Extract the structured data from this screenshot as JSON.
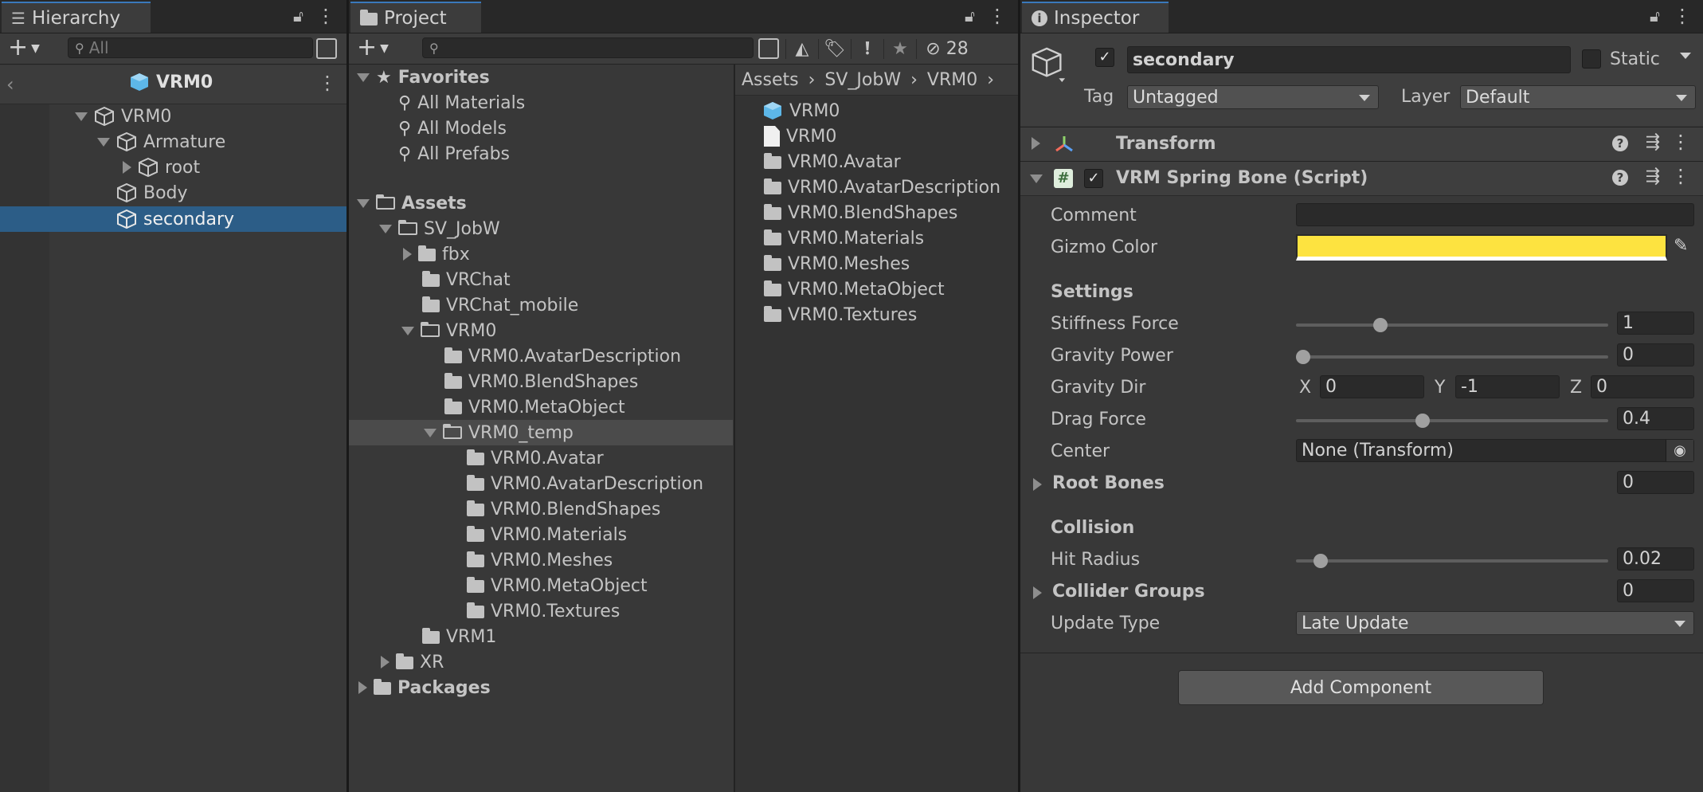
{
  "hierarchy": {
    "tab_label": "Hierarchy",
    "search_placeholder": "All",
    "scene_name": "VRM0",
    "items": [
      {
        "label": "VRM0"
      },
      {
        "label": "Armature"
      },
      {
        "label": "root"
      },
      {
        "label": "Body"
      },
      {
        "label": "secondary"
      }
    ]
  },
  "project": {
    "tab_label": "Project",
    "hidden_count": "28",
    "favorites": {
      "label": "Favorites",
      "items": [
        "All Materials",
        "All Models",
        "All Prefabs"
      ]
    },
    "tree": [
      {
        "label": "Assets"
      },
      {
        "label": "SV_JobW"
      },
      {
        "label": "fbx"
      },
      {
        "label": "VRChat"
      },
      {
        "label": "VRChat_mobile"
      },
      {
        "label": "VRM0"
      },
      {
        "label": "VRM0.AvatarDescription"
      },
      {
        "label": "VRM0.BlendShapes"
      },
      {
        "label": "VRM0.MetaObject"
      },
      {
        "label": "VRM0_temp"
      },
      {
        "label": "VRM0.Avatar"
      },
      {
        "label": "VRM0.AvatarDescription"
      },
      {
        "label": "VRM0.BlendShapes"
      },
      {
        "label": "VRM0.Materials"
      },
      {
        "label": "VRM0.Meshes"
      },
      {
        "label": "VRM0.MetaObject"
      },
      {
        "label": "VRM0.Textures"
      },
      {
        "label": "VRM1"
      },
      {
        "label": "XR"
      },
      {
        "label": "Packages"
      }
    ],
    "breadcrumb": [
      "Assets",
      "SV_JobW",
      "VRM0"
    ],
    "files": [
      {
        "label": "VRM0",
        "icon": "prefab-icon"
      },
      {
        "label": "VRM0",
        "icon": "file-icon"
      },
      {
        "label": "VRM0.Avatar",
        "icon": "folder-icon"
      },
      {
        "label": "VRM0.AvatarDescription",
        "icon": "folder-icon"
      },
      {
        "label": "VRM0.BlendShapes",
        "icon": "folder-icon"
      },
      {
        "label": "VRM0.Materials",
        "icon": "folder-icon"
      },
      {
        "label": "VRM0.Meshes",
        "icon": "folder-icon"
      },
      {
        "label": "VRM0.MetaObject",
        "icon": "folder-icon"
      },
      {
        "label": "VRM0.Textures",
        "icon": "folder-icon"
      }
    ]
  },
  "inspector": {
    "tab_label": "Inspector",
    "object_name": "secondary",
    "static_label": "Static",
    "tag_label": "Tag",
    "tag_value": "Untagged",
    "layer_label": "Layer",
    "layer_value": "Default",
    "transform_label": "Transform",
    "component_label": "VRM Spring Bone (Script)",
    "comment_label": "Comment",
    "comment_value": "",
    "gizmo_label": "Gizmo Color",
    "gizmo_color": "#fde340",
    "settings_header": "Settings",
    "stiffness_label": "Stiffness Force",
    "stiffness_value": "1",
    "stiffness_fraction": 0.26,
    "gravity_power_label": "Gravity Power",
    "gravity_power_value": "0",
    "gravity_power_fraction": 0.0,
    "gravity_dir_label": "Gravity Dir",
    "gravity_x_label": "X",
    "gravity_x": "0",
    "gravity_y_label": "Y",
    "gravity_y": "-1",
    "gravity_z_label": "Z",
    "gravity_z": "0",
    "drag_label": "Drag Force",
    "drag_value": "0.4",
    "drag_fraction": 0.4,
    "center_label": "Center",
    "center_value": "None (Transform)",
    "root_bones_label": "Root Bones",
    "root_bones_value": "0",
    "collision_header": "Collision",
    "hit_radius_label": "Hit Radius",
    "hit_radius_value": "0.02",
    "hit_radius_fraction": 0.06,
    "collider_groups_label": "Collider Groups",
    "collider_groups_value": "0",
    "update_type_label": "Update Type",
    "update_type_value": "Late Update",
    "add_component_label": "Add Component"
  }
}
